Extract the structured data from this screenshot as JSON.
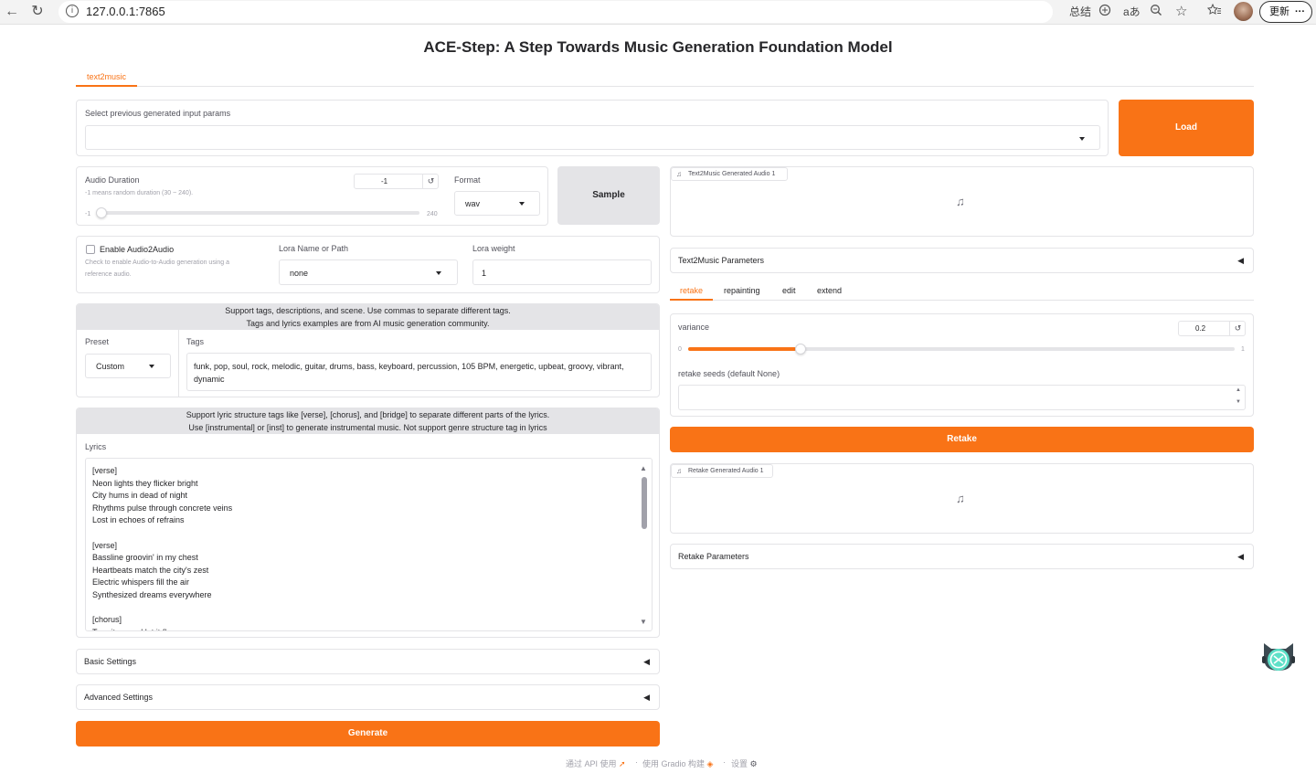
{
  "browser": {
    "url": "127.0.0.1:7865",
    "summary_label": "总结",
    "update_label": "更新",
    "more_label": "···"
  },
  "page": {
    "title": "ACE-Step: A Step Towards Music Generation Foundation Model",
    "tabs": [
      {
        "label": "text2music",
        "active": true
      }
    ]
  },
  "history": {
    "label": "Select previous generated input params",
    "value": "",
    "load_button": "Load"
  },
  "duration": {
    "label": "Audio Duration",
    "info": "-1 means random duration (30 ~ 240).",
    "value": "-1",
    "min": "-1",
    "max": "240",
    "level": 0
  },
  "format": {
    "label": "Format",
    "value": "wav"
  },
  "sample_button": "Sample",
  "audio2audio": {
    "label": "Enable Audio2Audio",
    "info_line1": "Check to enable Audio-to-Audio generation using a",
    "info_line2": "reference audio.",
    "checked": false
  },
  "lora": {
    "name_label": "Lora Name or Path",
    "name_value": "none",
    "weight_label": "Lora weight",
    "weight_value": "1"
  },
  "tags_banner": {
    "line1": "Support tags, descriptions, and scene. Use commas to separate different tags.",
    "line2": "Tags and lyrics examples are from AI music generation community."
  },
  "preset": {
    "label": "Preset",
    "value": "Custom"
  },
  "tags": {
    "label": "Tags",
    "line1": "funk, pop, soul, rock, melodic, guitar, drums, bass, keyboard, percussion, 105 BPM, energetic, upbeat, groovy, vibrant,",
    "line2": "dynamic"
  },
  "lyrics_banner": {
    "line1": "Support lyric structure tags like [verse], [chorus], and [bridge] to separate different parts of the lyrics.",
    "line2": "Use [instrumental] or [inst] to generate instrumental music. Not support genre structure tag in lyrics"
  },
  "lyrics": {
    "label": "Lyrics",
    "text": "[verse]\nNeon lights they flicker bright\nCity hums in dead of night\nRhythms pulse through concrete veins\nLost in echoes of refrains\n\n[verse]\nBassline groovin' in my chest\nHeartbeats match the city's zest\nElectric whispers fill the air\nSynthesized dreams everywhere\n\n[chorus]\nTurn it up and let it flow"
  },
  "basic_settings": "Basic Settings",
  "advanced_settings": "Advanced Settings",
  "generate_button": "Generate",
  "output": {
    "audio_label": "Text2Music Generated Audio 1",
    "params_label": "Text2Music Parameters"
  },
  "edit_tabs": [
    {
      "label": "retake",
      "active": true
    },
    {
      "label": "repainting",
      "active": false
    },
    {
      "label": "edit",
      "active": false
    },
    {
      "label": "extend",
      "active": false
    }
  ],
  "retake": {
    "variance_label": "variance",
    "variance_value": "0.2",
    "variance_min": "0",
    "variance_max": "1",
    "variance_level": 0.2,
    "seeds_label": "retake seeds (default None)",
    "seeds_value": "",
    "button": "Retake",
    "audio_label": "Retake Generated Audio 1",
    "params_label": "Retake Parameters"
  },
  "footer": {
    "api": "通过 API 使用",
    "built": "使用 Gradio 构建",
    "settings": "设置",
    "sep": "·"
  },
  "colors": {
    "accent": "#f97316",
    "banner": "#e4e4e7",
    "border": "#e4e4e7"
  },
  "icons": [
    "back-icon",
    "reload-icon",
    "info-icon",
    "translate-icon",
    "zoom-icon",
    "star-icon",
    "favorites-icon",
    "music-note-icon",
    "reset-icon",
    "collapse-arrow-icon",
    "rocket-icon",
    "gradio-logo-icon",
    "gear-icon",
    "assistant-cat-icon"
  ]
}
